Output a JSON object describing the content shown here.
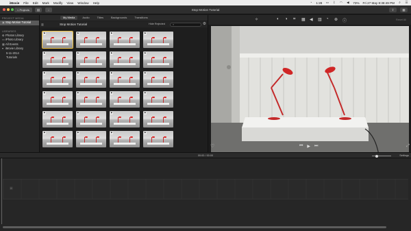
{
  "menubar": {
    "app": "iMovie",
    "items": [
      "File",
      "Edit",
      "Mark",
      "Modify",
      "View",
      "Window",
      "Help"
    ],
    "clock": "Fri 27 May  8:38:49 PM",
    "battery": "73%",
    "time_short": "1:28"
  },
  "toolbar": {
    "projects_label": "< Projects",
    "title": "Stop Motion Tutorial"
  },
  "sidebar": {
    "project_media_label": "PROJECT MEDIA",
    "project_item": "Stop Motion Tutorial",
    "libraries_label": "LIBRARIES",
    "items": [
      {
        "label": "Photos Library",
        "icon": "photos-icon"
      },
      {
        "label": "iPhoto Library",
        "icon": "iphoto-icon"
      },
      {
        "label": "All Events",
        "icon": "events-icon"
      },
      {
        "label": "iMovie Library",
        "icon": "library-icon"
      },
      {
        "label": "5-11-2014",
        "icon": ""
      },
      {
        "label": "Tutorials",
        "icon": ""
      }
    ]
  },
  "browser": {
    "tabs": [
      "My Media",
      "Audio",
      "Titles",
      "Backgrounds",
      "Transitions"
    ],
    "active_tab": "My Media",
    "event_title": "Stop Motion Tutorial",
    "filter_label": "Hide Rejected",
    "search_placeholder": "",
    "clip_count": 24,
    "selected_clip": 0
  },
  "viewer": {
    "reset_label": "Reset All"
  },
  "timeline": {
    "timecode": "00:00 / 00:00",
    "settings_label": "Settings"
  },
  "colors": {
    "accent_selection": "#f0c340",
    "lamp_red": "#c42a2a"
  }
}
